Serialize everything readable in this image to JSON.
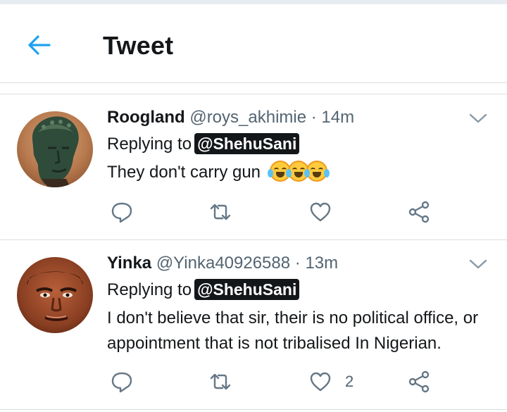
{
  "header": {
    "title": "Tweet"
  },
  "tweets": [
    {
      "name": "Roogland",
      "handle": "@roys_akhimie",
      "separator": "·",
      "time": "14m",
      "replying_to_label": "Replying to",
      "mention": "@ShehuSani",
      "text": "They don't carry gun",
      "emoji": "😂😂😂",
      "like_count": ""
    },
    {
      "name": "Yinka",
      "handle": "@Yinka40926588",
      "separator": "·",
      "time": "13m",
      "replying_to_label": "Replying to",
      "mention": "@ShehuSani",
      "text": "I don't believe that sir, their is no political office, or appointment that is not tribalised In Nigerian.",
      "like_count": "2"
    }
  ],
  "colors": {
    "accent": "#1da1f2",
    "icon": "#657786",
    "text": "#14171a",
    "secondary": "#536471"
  },
  "icons": [
    "back-arrow-icon",
    "chevron-down-icon",
    "reply-icon",
    "retweet-icon",
    "heart-icon",
    "share-icon"
  ]
}
